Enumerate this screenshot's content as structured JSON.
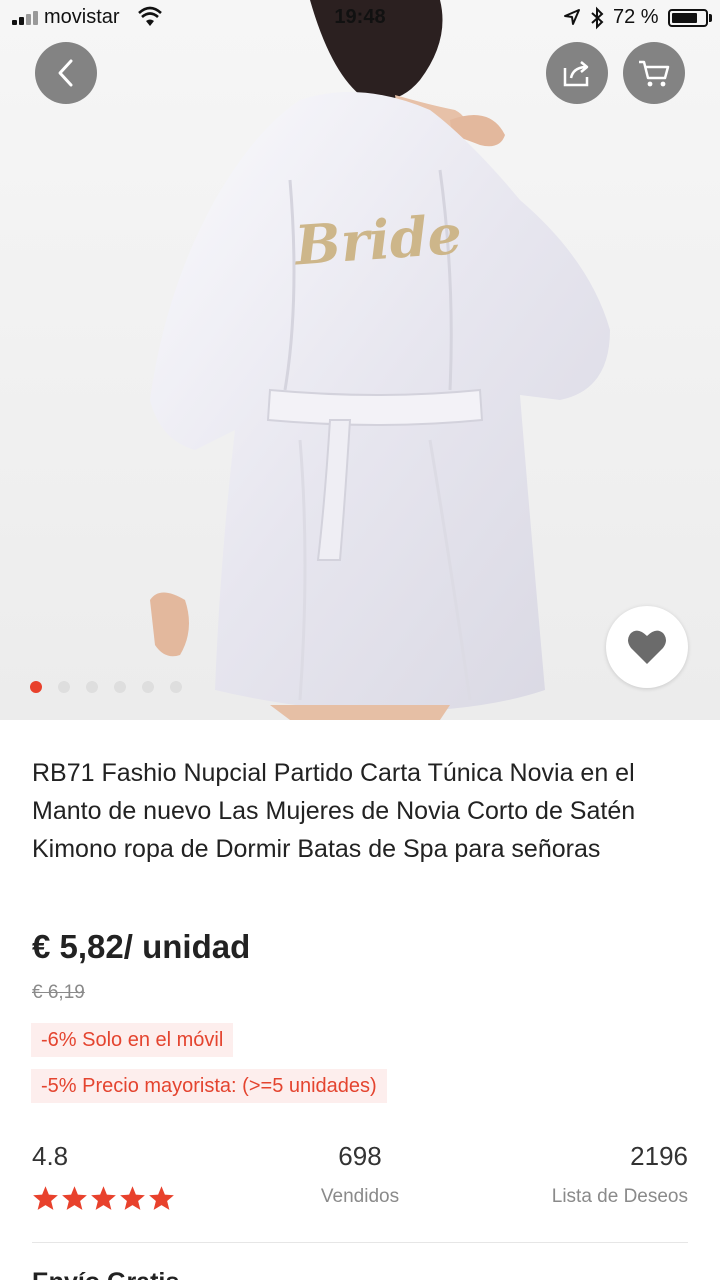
{
  "status_bar": {
    "carrier": "movistar",
    "time": "19:48",
    "battery_percent_label": "72 %",
    "battery_level": 0.72
  },
  "hero": {
    "robe_print": "Bride",
    "slide_count": 6,
    "active_slide": 1
  },
  "product": {
    "title": "RB71 Fashio Nupcial Partido Carta Túnica Novia en el Manto de nuevo Las Mujeres de Novia Corto de Satén Kimono ropa de Dormir Batas de Spa para señoras",
    "price": "€ 5,82/ unidad",
    "original_price": "€ 6,19",
    "promos": [
      "-6% Solo en el móvil",
      "-5% Precio mayorista: (>=5 unidades)"
    ]
  },
  "stats": {
    "rating": "4.8",
    "rating_value": 4.8,
    "stars_max": 5,
    "sold": "698",
    "sold_label": "Vendidos",
    "wishlist": "2196",
    "wishlist_label": "Lista de Deseos"
  },
  "next_section": {
    "heading_partial": "Envío Gratis"
  },
  "colors": {
    "accent": "#e8412c",
    "promo_bg": "#fdeeed",
    "promo_text": "#e4442f",
    "star": "#e8412c",
    "nav_button": "#6e6e6e"
  },
  "icons": [
    "back-arrow-icon",
    "share-icon",
    "cart-icon",
    "heart-icon",
    "wifi-icon",
    "location-arrow-icon",
    "bluetooth-icon",
    "battery-icon",
    "star-icon"
  ]
}
